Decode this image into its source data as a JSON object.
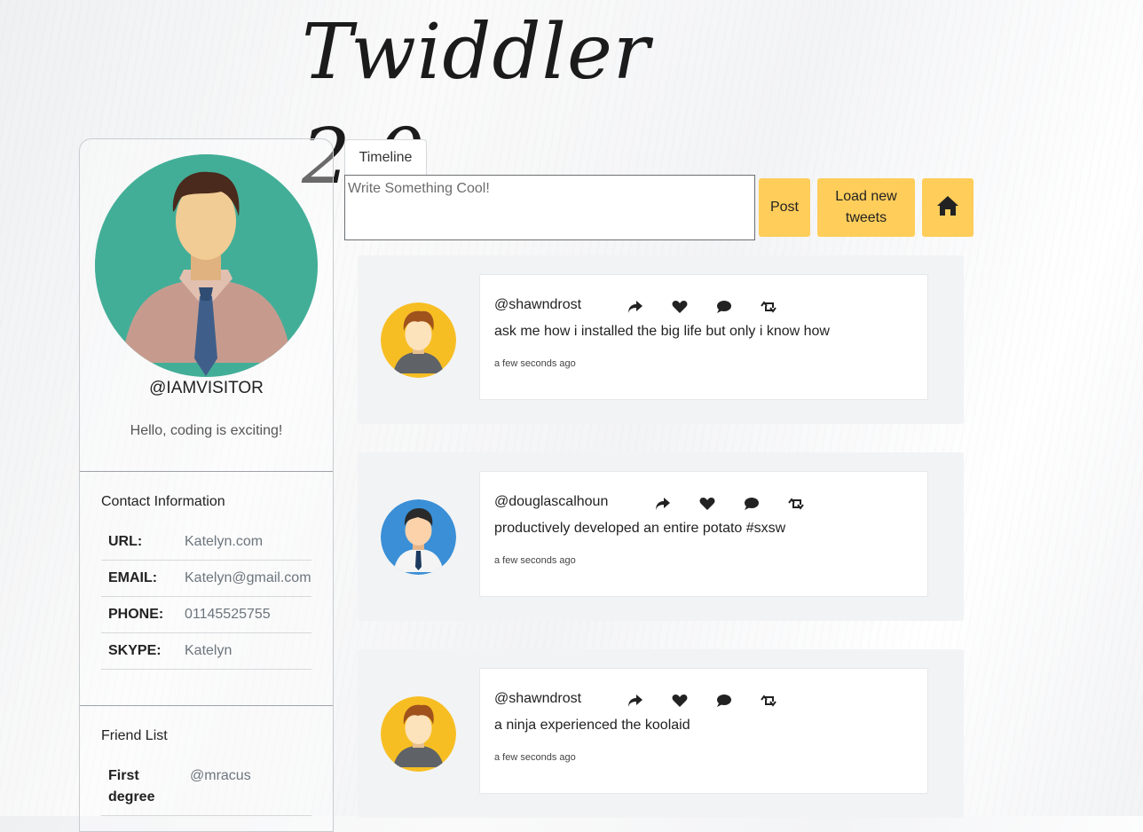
{
  "site": {
    "title": "Twiddler 2.0"
  },
  "profile": {
    "handle": "@IAMVISITOR",
    "bio": "Hello, coding is exciting!",
    "contact_heading": "Contact Information",
    "contact": [
      {
        "key": "URL:",
        "value": "Katelyn.com"
      },
      {
        "key": "EMAIL:",
        "value": "Katelyn@gmail.com"
      },
      {
        "key": "PHONE:",
        "value": "01145525755"
      },
      {
        "key": "SKYPE:",
        "value": "Katelyn"
      }
    ],
    "friends_heading": "Friend List",
    "friends": [
      {
        "key": "First degree",
        "value": "@mracus"
      }
    ]
  },
  "timeline": {
    "tab_label": "Timeline",
    "compose_placeholder": "Write Something Cool!",
    "post_label": "Post",
    "load_label": "Load new tweets",
    "home_icon": "home-icon"
  },
  "tweets": [
    {
      "user": "@shawndrost",
      "text": "ask me how i installed the big life but only i know how",
      "time": "a few seconds ago",
      "avatar": "yellow-hoodie"
    },
    {
      "user": "@douglascalhoun",
      "text": "productively developed an entire potato #sxsw",
      "time": "a few seconds ago",
      "avatar": "blue-tie"
    },
    {
      "user": "@shawndrost",
      "text": "a ninja experienced the koolaid",
      "time": "a few seconds ago",
      "avatar": "yellow-hoodie"
    }
  ],
  "colors": {
    "accent": "#ffcd5a",
    "card_bg": "#f2f3f5",
    "avatar_teal": "#43ae98",
    "avatar_yellow": "#f7be24",
    "avatar_blue": "#3a8fd6"
  }
}
